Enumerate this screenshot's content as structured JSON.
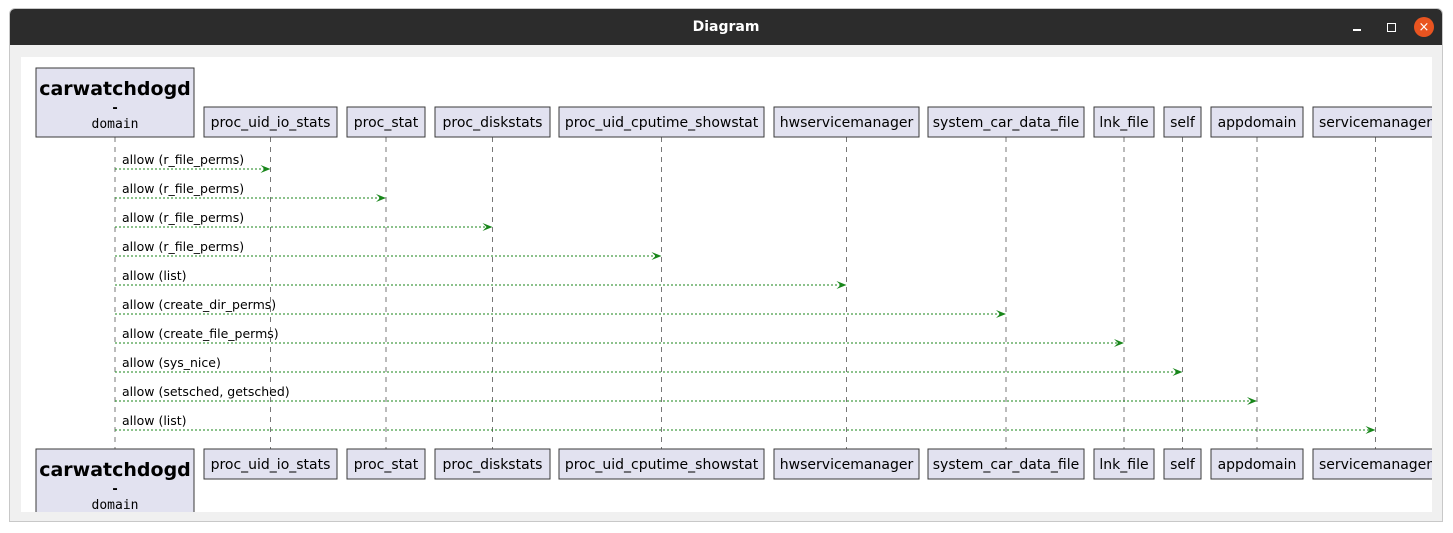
{
  "window": {
    "title": "Diagram",
    "minimize_icon": "minimize-icon",
    "maximize_icon": "maximize-icon",
    "close_icon": "close-icon",
    "close_symbol": "×",
    "accent_close": "#e95420",
    "titlebar_color": "#2c2c2c"
  },
  "diagram": {
    "type": "sequence",
    "source": {
      "title": "carwatchdogd",
      "separator": "-",
      "subtitle": "domain"
    },
    "participants": [
      "proc_uid_io_stats",
      "proc_stat",
      "proc_diskstats",
      "proc_uid_cputime_showstat",
      "hwservicemanager",
      "system_car_data_file",
      "lnk_file",
      "self",
      "appdomain",
      "servicemanager"
    ],
    "messages": [
      {
        "to": 0,
        "label": "allow (r_file_perms)"
      },
      {
        "to": 1,
        "label": "allow (r_file_perms)"
      },
      {
        "to": 2,
        "label": "allow (r_file_perms)"
      },
      {
        "to": 3,
        "label": "allow (r_file_perms)"
      },
      {
        "to": 4,
        "label": "allow (list)"
      },
      {
        "to": 5,
        "label": "allow (create_dir_perms)"
      },
      {
        "to": 6,
        "label": "allow (create_file_perms)"
      },
      {
        "to": 7,
        "label": "allow (sys_nice)"
      },
      {
        "to": 8,
        "label": "allow (setsched, getsched)"
      },
      {
        "to": 9,
        "label": "allow (list)"
      }
    ],
    "colors": {
      "participant_fill": "#e2e2f0",
      "arrow": "#18861a",
      "lifeline": "#777777"
    }
  }
}
